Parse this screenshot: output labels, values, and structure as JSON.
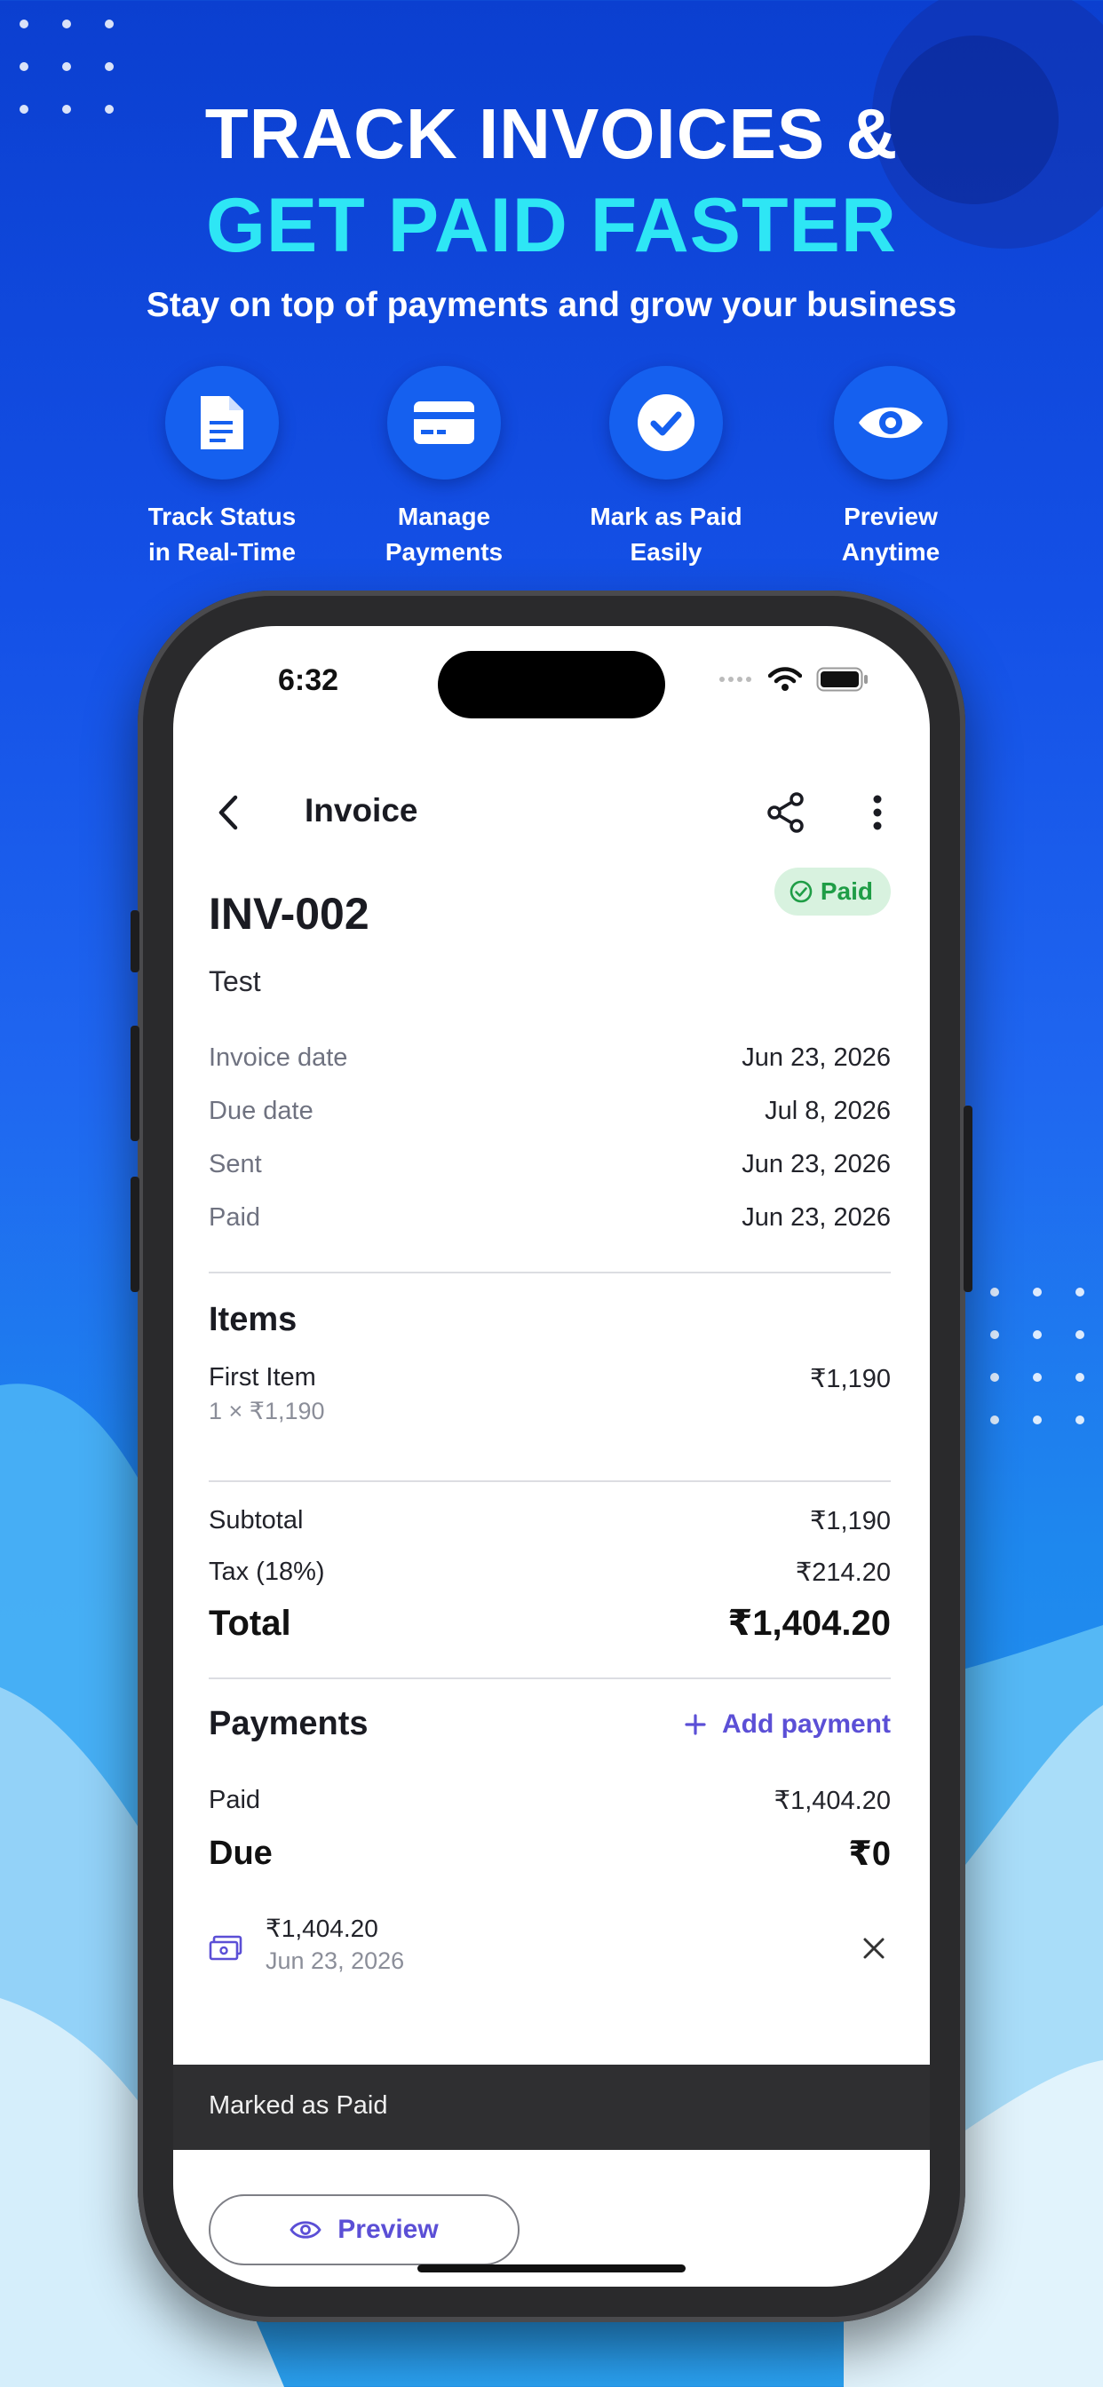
{
  "promo": {
    "headline_line1": "TRACK INVOICES &",
    "headline_line2": "GET PAID FASTER",
    "subtitle": "Stay on top of payments and grow your business",
    "features": [
      {
        "label": "Track Status\nin Real-Time",
        "icon": "document-icon"
      },
      {
        "label": "Manage\nPayments",
        "icon": "credit-card-icon"
      },
      {
        "label": "Mark as Paid\nEasily",
        "icon": "checkmark-icon"
      },
      {
        "label": "Preview\nAnytime",
        "icon": "eye-icon"
      }
    ]
  },
  "status_bar": {
    "time": "6:32"
  },
  "app_bar": {
    "title": "Invoice"
  },
  "invoice": {
    "number": "INV-002",
    "client": "Test",
    "status": "Paid",
    "dates": [
      {
        "label": "Invoice date",
        "value": "Jun 23, 2026"
      },
      {
        "label": "Due date",
        "value": "Jul 8, 2026"
      },
      {
        "label": "Sent",
        "value": "Jun 23, 2026"
      },
      {
        "label": "Paid",
        "value": "Jun 23, 2026"
      }
    ]
  },
  "items": {
    "title": "Items",
    "list": [
      {
        "name": "First Item",
        "detail": "1 × ₹1,190",
        "amount": "₹1,190"
      }
    ]
  },
  "totals": {
    "subtotal_label": "Subtotal",
    "subtotal": "₹1,190",
    "tax_label": "Tax (18%)",
    "tax": "₹214.20",
    "total_label": "Total",
    "total": "₹1,404.20"
  },
  "payments": {
    "title": "Payments",
    "add_label": "Add payment",
    "paid_label": "Paid",
    "paid": "₹1,404.20",
    "due_label": "Due",
    "due": "₹0",
    "entries": [
      {
        "amount": "₹1,404.20",
        "date": "Jun 23, 2026"
      }
    ]
  },
  "snackbar": {
    "message": "Marked as Paid"
  },
  "footer": {
    "preview_label": "Preview"
  },
  "colors": {
    "accent": "#5b4fd6",
    "paid_green": "#1f9d46",
    "headline_cyan": "#2ee6f5"
  }
}
